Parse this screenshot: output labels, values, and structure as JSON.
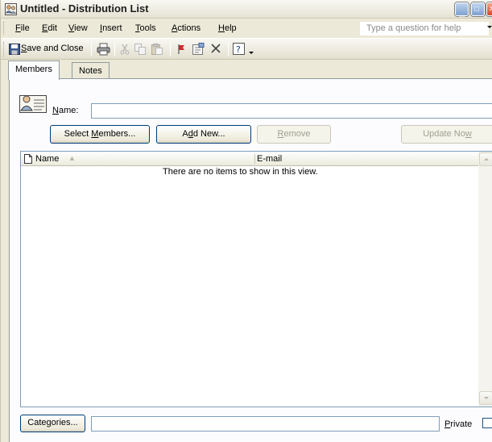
{
  "window": {
    "title": "Untitled - Distribution List"
  },
  "menubar": {
    "items": [
      {
        "pre": "",
        "key": "F",
        "post": "ile"
      },
      {
        "pre": "",
        "key": "E",
        "post": "dit"
      },
      {
        "pre": "",
        "key": "V",
        "post": "iew"
      },
      {
        "pre": "",
        "key": "I",
        "post": "nsert"
      },
      {
        "pre": "",
        "key": "T",
        "post": "ools"
      },
      {
        "pre": "",
        "key": "A",
        "post": "ctions"
      },
      {
        "pre": "",
        "key": "H",
        "post": "elp"
      }
    ],
    "help_placeholder": "Type a question for help"
  },
  "toolbar": {
    "save_key": "S",
    "save_rest": "ave and Close"
  },
  "tabs": [
    {
      "label": "Members",
      "active": true
    },
    {
      "label": "Notes",
      "active": false
    }
  ],
  "form": {
    "name_key": "N",
    "name_rest": "ame:",
    "name_value": ""
  },
  "buttons": {
    "select_members": {
      "pre": "Select ",
      "key": "M",
      "post": "embers..."
    },
    "add_new": {
      "pre": "A",
      "key": "d",
      "post": "d New..."
    },
    "remove": {
      "pre": "",
      "key": "R",
      "post": "emove"
    },
    "update_now": {
      "pre": "Update No",
      "key": "w",
      "post": ""
    }
  },
  "listview": {
    "columns": [
      {
        "label": "Name",
        "sorted": true
      },
      {
        "label": "E-mail"
      }
    ],
    "empty_message": "There are no items to show in this view."
  },
  "bottom": {
    "categories_pre": "Cate",
    "categories_key": "g",
    "categories_post": "ories...",
    "categories_value": "",
    "private_key": "P",
    "private_rest": "rivate",
    "private_checked": false
  },
  "colors": {
    "face": "#ece9d8",
    "border_blue": "#7f9db9",
    "button_border": "#003c74"
  }
}
